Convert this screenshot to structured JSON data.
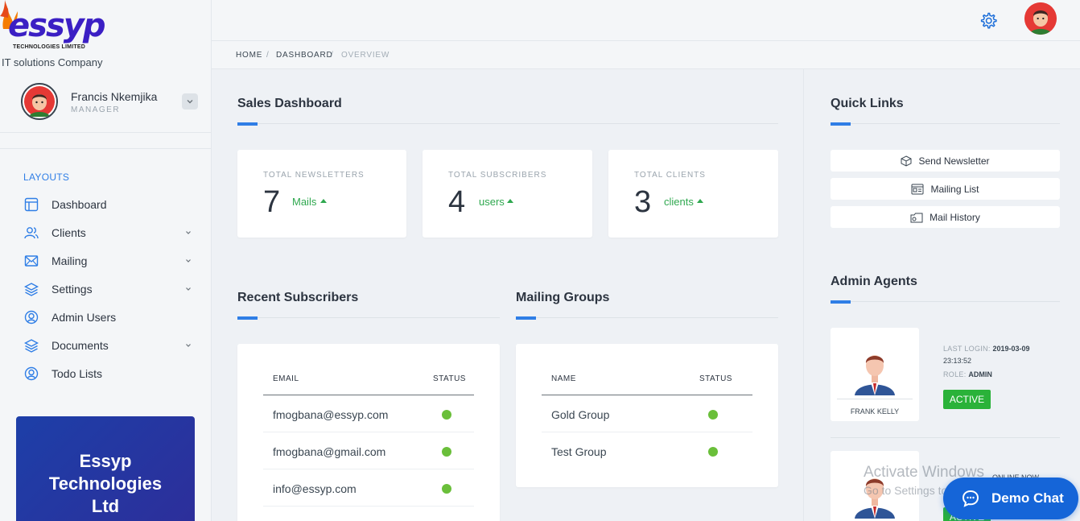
{
  "brand": {
    "logo_text": "essyp",
    "logo_sub": "TECHNOLOGIES LIMITED",
    "tagline": "IT solutions Company"
  },
  "user": {
    "name": "Francis Nkemjika",
    "role": "MANAGER"
  },
  "nav": {
    "heading": "LAYOUTS",
    "items": [
      {
        "label": "Dashboard",
        "icon": "dashboard-icon",
        "has_children": false
      },
      {
        "label": "Clients",
        "icon": "users-icon",
        "has_children": true
      },
      {
        "label": "Mailing",
        "icon": "mail-icon",
        "has_children": true
      },
      {
        "label": "Settings",
        "icon": "layers-icon",
        "has_children": true
      },
      {
        "label": "Admin Users",
        "icon": "user-circle-icon",
        "has_children": false
      },
      {
        "label": "Documents",
        "icon": "layers-icon",
        "has_children": true
      },
      {
        "label": "Todo Lists",
        "icon": "user-circle-icon",
        "has_children": false
      }
    ]
  },
  "promo": {
    "line1": "Essyp",
    "line2": "Technologies",
    "line3": "Ltd"
  },
  "breadcrumb": [
    "HOME",
    "DASHBOARD",
    "OVERVIEW"
  ],
  "sales": {
    "title": "Sales Dashboard",
    "stats": [
      {
        "label": "TOTAL NEWSLETTERS",
        "value": "7",
        "unit": "Mails"
      },
      {
        "label": "TOTAL SUBSCRIBERS",
        "value": "4",
        "unit": "users"
      },
      {
        "label": "TOTAL CLIENTS",
        "value": "3",
        "unit": "clients"
      }
    ]
  },
  "subscribers": {
    "title": "Recent Subscribers",
    "columns": [
      "EMAIL",
      "STATUS"
    ],
    "rows": [
      {
        "email": "fmogbana@essyp.com",
        "status": "active"
      },
      {
        "email": "fmogbana@gmail.com",
        "status": "active"
      },
      {
        "email": "info@essyp.com",
        "status": "active"
      }
    ]
  },
  "groups": {
    "title": "Mailing Groups",
    "columns": [
      "NAME",
      "STATUS"
    ],
    "rows": [
      {
        "name": "Gold Group",
        "status": "active"
      },
      {
        "name": "Test Group",
        "status": "active"
      }
    ]
  },
  "quick_links": {
    "title": "Quick Links",
    "items": [
      {
        "label": "Send Newsletter",
        "icon": "box-icon"
      },
      {
        "label": "Mailing List",
        "icon": "list-icon"
      },
      {
        "label": "Mail History",
        "icon": "history-icon"
      }
    ]
  },
  "agents": {
    "title": "Admin Agents",
    "list": [
      {
        "name": "FRANK KELLY",
        "last_login_label": "LAST LOGIN:",
        "last_login_date": "2019-03-09",
        "last_login_time": "23:13:52",
        "role_label": "ROLE:",
        "role": "ADMIN",
        "status": "ACTIVE"
      },
      {
        "status": "ACTIVE"
      }
    ]
  },
  "watermark": {
    "line1": "Activate Windows",
    "line2": "Go to Settings to activate Windows."
  },
  "chat": {
    "online_label": "ONLINE NOW",
    "button_label": "Demo Chat"
  },
  "colors": {
    "accent": "#2f7ee6",
    "success": "#2ab239",
    "status_dot": "#6abf3a",
    "chat": "#1565d8"
  }
}
